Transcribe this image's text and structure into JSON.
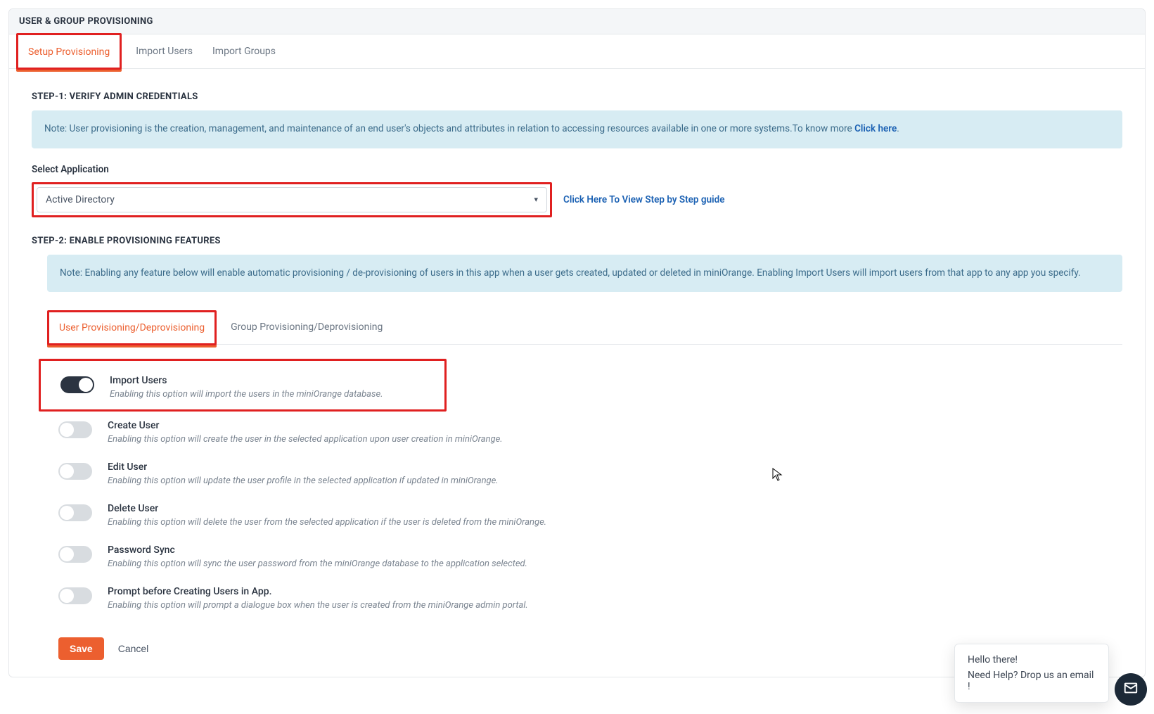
{
  "header": {
    "title": "USER & GROUP PROVISIONING"
  },
  "tabs": [
    {
      "label": "Setup Provisioning",
      "active": true
    },
    {
      "label": "Import Users",
      "active": false
    },
    {
      "label": "Import Groups",
      "active": false
    }
  ],
  "step1": {
    "title": "STEP-1: VERIFY ADMIN CREDENTIALS",
    "note_prefix": "Note: User provisioning is the creation, management, and maintenance of an end user's objects and attributes in relation to accessing resources available in one or more systems.To know more ",
    "note_link": "Click here",
    "note_suffix": ".",
    "select_label": "Select Application",
    "select_value": "Active Directory",
    "guide_link": "Click Here To View Step by Step guide"
  },
  "step2": {
    "title": "STEP-2: ENABLE PROVISIONING FEATURES",
    "note": "Note: Enabling any feature below will enable automatic provisioning / de-provisioning of users in this app when a user gets created, updated or deleted in miniOrange. Enabling Import Users will import users from that app to any app you specify."
  },
  "subtabs": [
    {
      "label": "User Provisioning/Deprovisioning",
      "active": true
    },
    {
      "label": "Group Provisioning/Deprovisioning",
      "active": false
    }
  ],
  "features": [
    {
      "title": "Import Users",
      "desc": "Enabling this option will import the users in the miniOrange database.",
      "on": true,
      "highlighted": true
    },
    {
      "title": "Create User",
      "desc": "Enabling this option will create the user in the selected application upon user creation in miniOrange.",
      "on": false
    },
    {
      "title": "Edit User",
      "desc": "Enabling this option will update the user profile in the selected application if updated in miniOrange.",
      "on": false
    },
    {
      "title": "Delete User",
      "desc": "Enabling this option will delete the user from the selected application if the user is deleted from the miniOrange.",
      "on": false
    },
    {
      "title": "Password Sync",
      "desc": "Enabling this option will sync the user password from the miniOrange database to the application selected.",
      "on": false
    },
    {
      "title": "Prompt before Creating Users in App.",
      "desc": "Enabling this option will prompt a dialogue box when the user is created from the miniOrange admin portal.",
      "on": false
    }
  ],
  "buttons": {
    "save": "Save",
    "cancel": "Cancel"
  },
  "chat": {
    "line1": "Hello there!",
    "line2": "Need Help? Drop us an email !"
  }
}
